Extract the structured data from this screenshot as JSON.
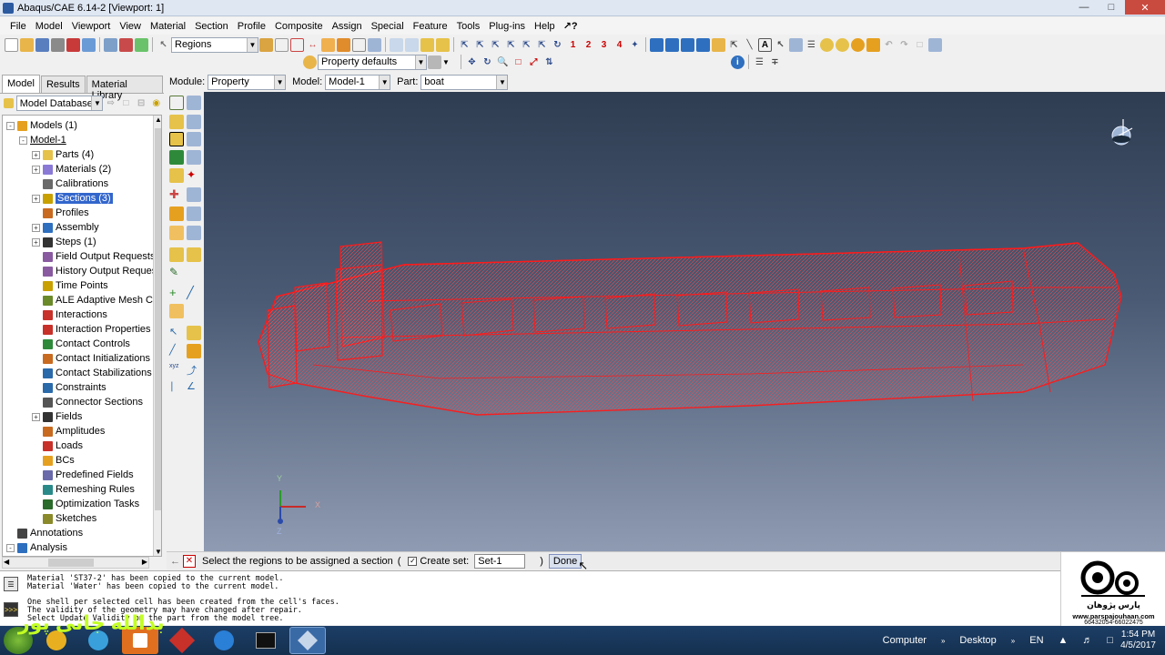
{
  "window": {
    "title": "Abaqus/CAE 6.14-2 [Viewport: 1]"
  },
  "menu": [
    "File",
    "Model",
    "Viewport",
    "View",
    "Material",
    "Section",
    "Profile",
    "Composite",
    "Assign",
    "Special",
    "Feature",
    "Tools",
    "Plug-ins",
    "Help"
  ],
  "toolbar": {
    "selection_combo": "Regions",
    "render_style": "Property defaults",
    "numbers": [
      "1",
      "2",
      "3",
      "4"
    ]
  },
  "module_bar": {
    "module_label": "Module:",
    "module_value": "Property",
    "model_label": "Model:",
    "model_value": "Model-1",
    "part_label": "Part:",
    "part_value": "boat"
  },
  "left_panel": {
    "tabs": [
      "Model",
      "Results",
      "Material Library"
    ],
    "database": "Model Database",
    "tree": [
      {
        "label": "Models (1)",
        "level": 0,
        "exp": "-",
        "icon": "models"
      },
      {
        "label": "Model-1",
        "level": 1,
        "exp": "-",
        "icon": "",
        "underline": true
      },
      {
        "label": "Parts (4)",
        "level": 2,
        "exp": "+",
        "icon": "parts"
      },
      {
        "label": "Materials (2)",
        "level": 2,
        "exp": "+",
        "icon": "materials"
      },
      {
        "label": "Calibrations",
        "level": 2,
        "exp": "",
        "icon": "calibrations"
      },
      {
        "label": "Sections (3)",
        "level": 2,
        "exp": "+",
        "icon": "sections",
        "selected": true
      },
      {
        "label": "Profiles",
        "level": 2,
        "exp": "",
        "icon": "profiles"
      },
      {
        "label": "Assembly",
        "level": 2,
        "exp": "+",
        "icon": "assembly"
      },
      {
        "label": "Steps (1)",
        "level": 2,
        "exp": "+",
        "icon": "steps"
      },
      {
        "label": "Field Output Requests",
        "level": 2,
        "exp": "",
        "icon": "field-output"
      },
      {
        "label": "History Output Requests",
        "level": 2,
        "exp": "",
        "icon": "history-output"
      },
      {
        "label": "Time Points",
        "level": 2,
        "exp": "",
        "icon": "time-points"
      },
      {
        "label": "ALE Adaptive Mesh Cons",
        "level": 2,
        "exp": "",
        "icon": "ale"
      },
      {
        "label": "Interactions",
        "level": 2,
        "exp": "",
        "icon": "interactions"
      },
      {
        "label": "Interaction Properties",
        "level": 2,
        "exp": "",
        "icon": "interaction-props"
      },
      {
        "label": "Contact Controls",
        "level": 2,
        "exp": "",
        "icon": "contact-controls"
      },
      {
        "label": "Contact Initializations",
        "level": 2,
        "exp": "",
        "icon": "contact-init"
      },
      {
        "label": "Contact Stabilizations",
        "level": 2,
        "exp": "",
        "icon": "contact-stab"
      },
      {
        "label": "Constraints",
        "level": 2,
        "exp": "",
        "icon": "constraints"
      },
      {
        "label": "Connector Sections",
        "level": 2,
        "exp": "",
        "icon": "connector"
      },
      {
        "label": "Fields",
        "level": 2,
        "exp": "+",
        "icon": "fields"
      },
      {
        "label": "Amplitudes",
        "level": 2,
        "exp": "",
        "icon": "amplitudes"
      },
      {
        "label": "Loads",
        "level": 2,
        "exp": "",
        "icon": "loads"
      },
      {
        "label": "BCs",
        "level": 2,
        "exp": "",
        "icon": "bcs"
      },
      {
        "label": "Predefined Fields",
        "level": 2,
        "exp": "",
        "icon": "predefined"
      },
      {
        "label": "Remeshing Rules",
        "level": 2,
        "exp": "",
        "icon": "remeshing"
      },
      {
        "label": "Optimization Tasks",
        "level": 2,
        "exp": "",
        "icon": "optimization"
      },
      {
        "label": "Sketches",
        "level": 2,
        "exp": "",
        "icon": "sketches"
      },
      {
        "label": "Annotations",
        "level": 0,
        "exp": "",
        "icon": "annotations"
      },
      {
        "label": "Analysis",
        "level": 0,
        "exp": "-",
        "icon": "analysis"
      }
    ]
  },
  "viewport": {
    "triad": {
      "y": "Y",
      "x": "X",
      "z": "Z"
    },
    "part_color": "#ff2020"
  },
  "prompt": {
    "text": "Select the regions to be assigned a section",
    "open_paren": "(",
    "create_set_label": "Create set:",
    "create_set_value": "Set-1",
    "close_paren": ")",
    "done_label": "Done"
  },
  "messages": [
    "Material 'ST37-2' has been copied to the current model.",
    "Material 'Water' has been copied to the current model.",
    "",
    "One shell per selected cell has been created from the cell's faces.",
    "The validity of the geometry may have changed after repair.",
    "Select Update Validity on the part from the model tree."
  ],
  "logo": {
    "brand": "پارس پژوهان",
    "url": "www.parspajouhaan.com",
    "phone": "66432054-66022475"
  },
  "watermark": "بدالله جانی پور",
  "taskbar": {
    "tray": [
      "Computer",
      "Desktop",
      "EN"
    ],
    "time": "1:54 PM",
    "date": "4/5/2017"
  }
}
